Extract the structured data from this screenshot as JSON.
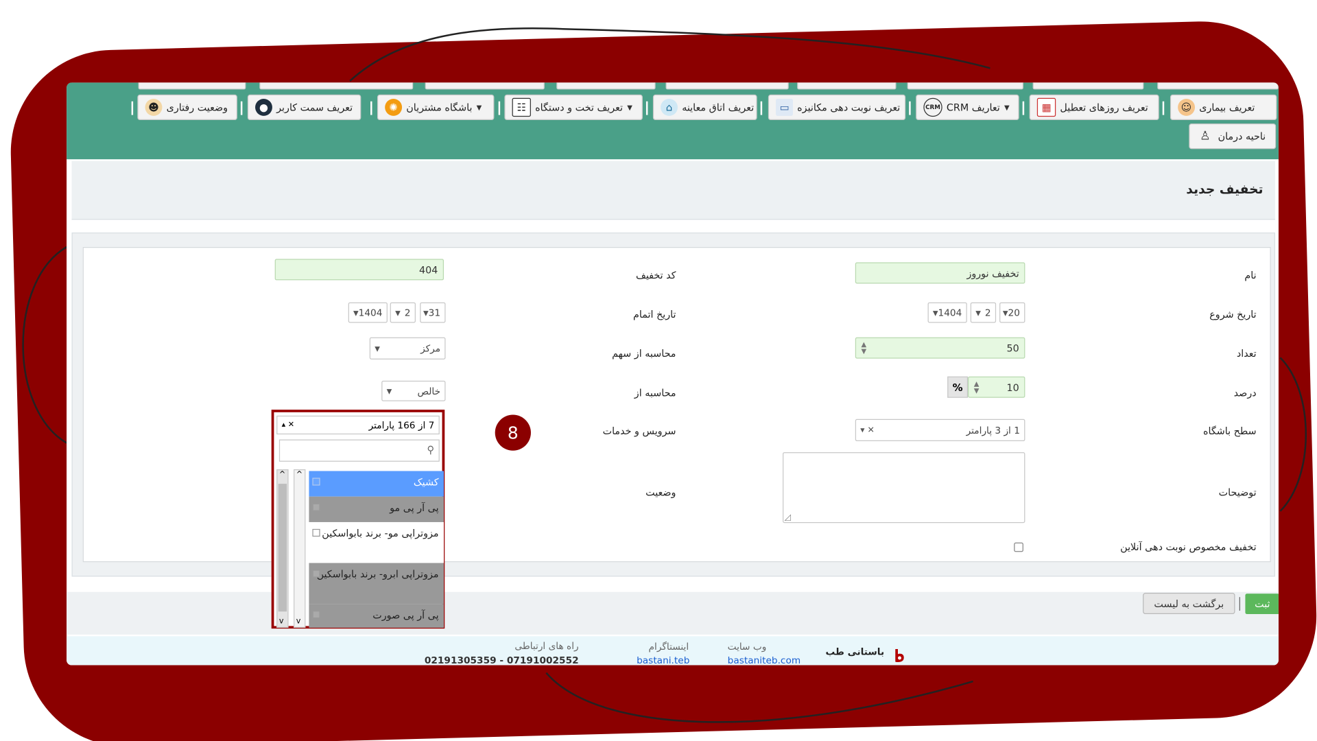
{
  "nav": {
    "row1": [
      {
        "label": "تعریف بیماری",
        "icon": "doctor-icon"
      },
      {
        "label": "تعریف روزهای تعطیل",
        "icon": "calendar-icon"
      },
      {
        "label": "تعاریف CRM",
        "icon": "crm-icon",
        "dropdown": true
      },
      {
        "label": "تعریف نوبت دهی مکانیزه",
        "icon": "monitor-icon"
      },
      {
        "label": "تعریف اتاق معاینه",
        "icon": "room-icon"
      },
      {
        "label": "تعریف تخت و دستگاه",
        "icon": "clipboard-icon",
        "dropdown": true
      },
      {
        "label": "باشگاه مشتریان",
        "icon": "people-icon",
        "dropdown": true
      },
      {
        "label": "تعریف سمت کاربر",
        "icon": "user-icon"
      },
      {
        "label": "وضعیت رفتاری",
        "icon": "head-icon"
      }
    ],
    "row2": [
      {
        "label": "ناحیه درمان",
        "icon": "body-icon"
      }
    ]
  },
  "page": {
    "title": "تخفیف جدید"
  },
  "form": {
    "name": {
      "label": "نام",
      "value": "تخفیف نوروز"
    },
    "code": {
      "label": "کد تخفیف",
      "value": "404"
    },
    "start_date": {
      "label": "تاریخ شروع",
      "day": "20",
      "month": "2",
      "year": "1404"
    },
    "end_date": {
      "label": "تاریخ اتمام",
      "day": "31",
      "month": "2",
      "year": "1404"
    },
    "count": {
      "label": "تعداد",
      "value": "50"
    },
    "share": {
      "label": "محاسبه از سهم",
      "value": "مرکز"
    },
    "percent": {
      "label": "درصد",
      "value": "10",
      "unit": "%"
    },
    "calc_from": {
      "label": "محاسبه از",
      "value": "خالص"
    },
    "club_level": {
      "label": "سطح باشگاه",
      "value": "1 از 3 پارامتر"
    },
    "services": {
      "label": "سرویس و خدمات",
      "value": "7 از 166 پارامتر"
    },
    "notes": {
      "label": "توضیحات"
    },
    "status": {
      "label": "وضعیت"
    },
    "online": {
      "label": "تخفیف مخصوص نوبت دهی آنلاین"
    }
  },
  "step_badge": "8",
  "services_options": [
    {
      "label": "کشیک",
      "state": "highlighted"
    },
    {
      "label": "پی آر پی مو",
      "state": "selected"
    },
    {
      "label": "مزوتراپی مو- برند بابواسکین",
      "state": "unselected"
    },
    {
      "label": "مزوتراپی ابرو- برند بابواسکین",
      "state": "selected"
    },
    {
      "label": "پی آر پی صورت",
      "state": "selected"
    }
  ],
  "buttons": {
    "save": "ثبت",
    "back": "برگشت به لیست"
  },
  "footer": {
    "brand": "باستانی طب",
    "website_title": "وب سایت",
    "website": "bastaniteb.com",
    "instagram_title": "اینستاگرام",
    "instagram": "bastani.teb",
    "contact_title": "راه های ارتباطی",
    "phones": "07191002552 - 02191305359"
  },
  "colors": {
    "frame": "#8b0000",
    "header": "#4aa088",
    "highlight": "#5a9cff",
    "selected": "#999999",
    "badge": "#8b0000",
    "save": "#5cb85c"
  }
}
